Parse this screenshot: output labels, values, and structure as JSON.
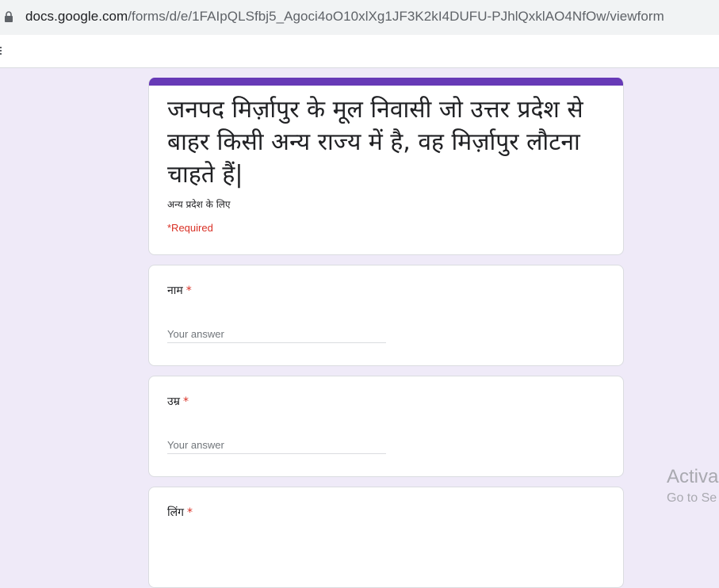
{
  "browser": {
    "url_domain": "docs.google.com",
    "url_path": "/forms/d/e/1FAIpQLSfbj5_Agoci4oO10xlXg1JF3K2kI4DUFU-PJhlQxklAO4NfOw/viewform"
  },
  "form": {
    "title": "जनपद मिर्ज़ापुर के मूल निवासी जो उत्तर प्रदेश से बाहर किसी अन्य राज्य में है, वह मिर्ज़ापुर लौटना चाहते हैं|",
    "description": "अन्य प्रदेश के लिए",
    "required_note": "*Required",
    "accent_color": "#673ab7"
  },
  "questions": [
    {
      "label": "नाम",
      "required_mark": "*",
      "placeholder": "Your answer"
    },
    {
      "label": "उम्र",
      "required_mark": "*",
      "placeholder": "Your answer"
    },
    {
      "label": "लिंग",
      "required_mark": "*"
    }
  ],
  "watermark": {
    "line1": "Activa",
    "line2": "Go to Se"
  }
}
